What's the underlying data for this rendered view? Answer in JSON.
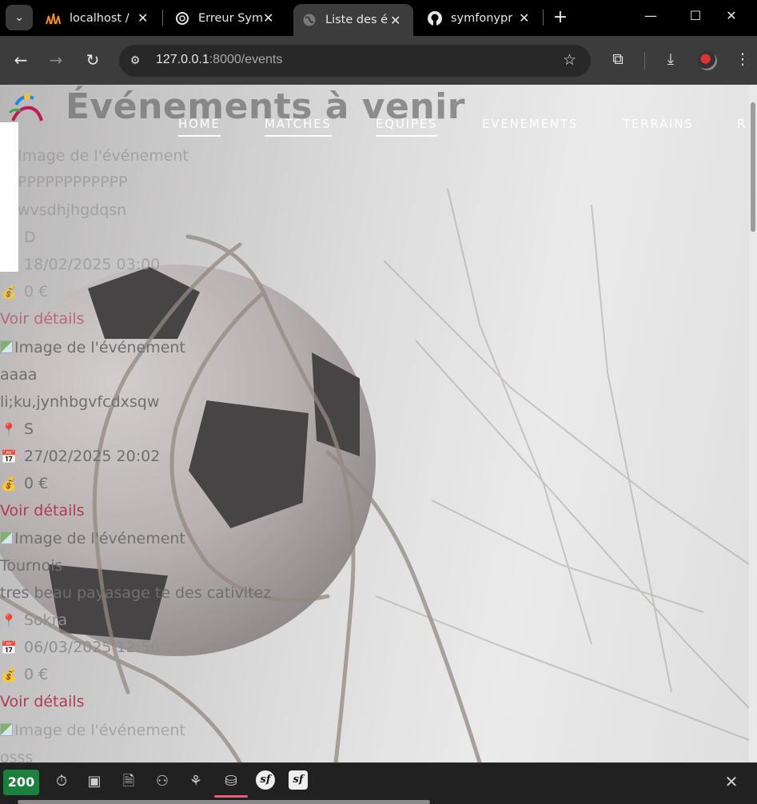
{
  "browser": {
    "tabs": [
      {
        "title": "localhost /",
        "favicon": "phpmyadmin-icon"
      },
      {
        "title": "Erreur Sym",
        "favicon": "openai-icon"
      },
      {
        "title": "Liste des é",
        "favicon": "globe-icon",
        "active": true
      },
      {
        "title": "symfonypr",
        "favicon": "github-icon"
      }
    ],
    "url_host": "127.0.0.1",
    "url_path": ":8000/events"
  },
  "page": {
    "heading": "Événements à venir",
    "nav": [
      "HOME",
      "MATCHES",
      "EQUIPES",
      "EVENEMENTS",
      "TERRAINS",
      "R"
    ]
  },
  "events": [
    {
      "img_alt": "Image de l'événement",
      "title": "PPPPPPPPPPPP",
      "description": "wvsdhjhgdqsn",
      "location": "D",
      "date": "18/02/2025 03:00",
      "price": "0 €",
      "link": "Voir détails"
    },
    {
      "img_alt": "Image de l'événement",
      "title": "aaaa",
      "description": "li;ku,jynhbgvfcdxsqw",
      "location": "S",
      "date": "27/02/2025 20:02",
      "price": "0 €",
      "link": "Voir détails"
    },
    {
      "img_alt": "Image de l'événement",
      "title": "Tournois",
      "description": "tres beau payasage te des cativitez",
      "location": "Sokra",
      "date": "06/03/2025 12:50",
      "price": "0 €",
      "link": "Voir détails"
    },
    {
      "img_alt": "Image de l'événement",
      "title": "osss"
    }
  ],
  "profiler": {
    "status_code": "200",
    "icons": [
      "time-icon",
      "memory-icon",
      "logs-icon",
      "user-icon",
      "twig-icon",
      "database-icon",
      "symfony-icon",
      "symfony-config-icon"
    ]
  },
  "colors": {
    "link": "#b23a55",
    "status_ok": "#1b7f3e",
    "active_indicator": "#e6607a"
  }
}
